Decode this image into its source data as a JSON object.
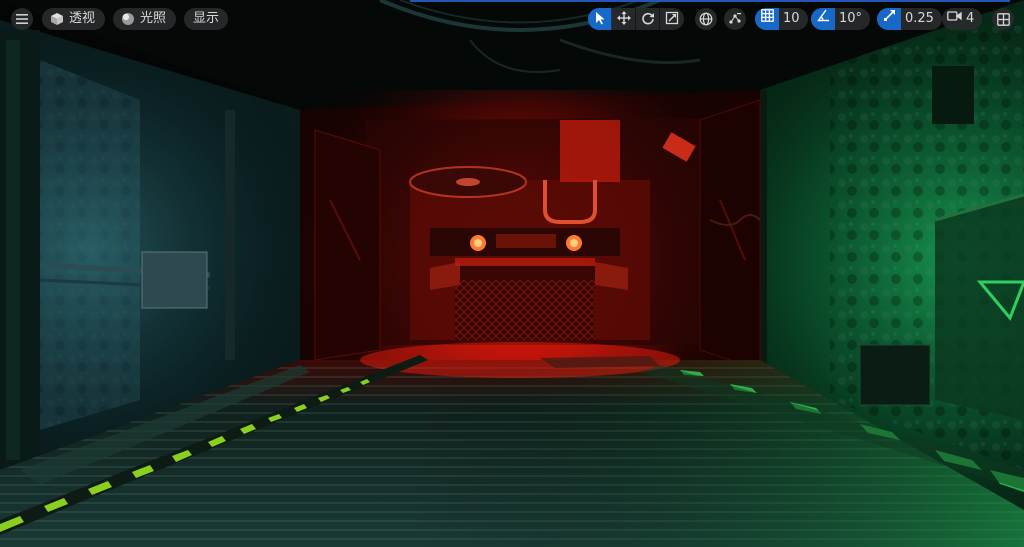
{
  "toolbar": {
    "menu_icon": "hamburger-menu-icon",
    "view_mode": {
      "label": "透视",
      "icon": "cube-icon"
    },
    "lighting": {
      "label": "光照",
      "icon": "lit-sphere-icon"
    },
    "show": {
      "label": "显示"
    },
    "transform_tools": [
      {
        "name": "select",
        "icon": "cursor-icon",
        "active": true
      },
      {
        "name": "move",
        "icon": "move-arrows-icon",
        "active": false
      },
      {
        "name": "rotate",
        "icon": "rotate-icon",
        "active": false
      },
      {
        "name": "scale",
        "icon": "scale-icon",
        "active": false
      }
    ],
    "coordinate_space_icon": "globe-icon",
    "surface_snap_icon": "surface-snap-icon",
    "grid_snap": {
      "value": "10",
      "icon": "grid-icon"
    },
    "rotation_snap": {
      "value": "10°",
      "icon": "angle-icon"
    },
    "scale_snap": {
      "value": "0.25",
      "icon": "scale-snap-icon"
    },
    "camera_speed": {
      "value": "4",
      "icon": "camera-icon"
    },
    "layout_icon": "viewport-layout-icon",
    "accent_color": "#1868c8"
  },
  "scene": {
    "description_colors": {
      "red_light": "#ff2010",
      "green_light": "#10c040",
      "hazard_yellow": "#8ad020"
    }
  }
}
